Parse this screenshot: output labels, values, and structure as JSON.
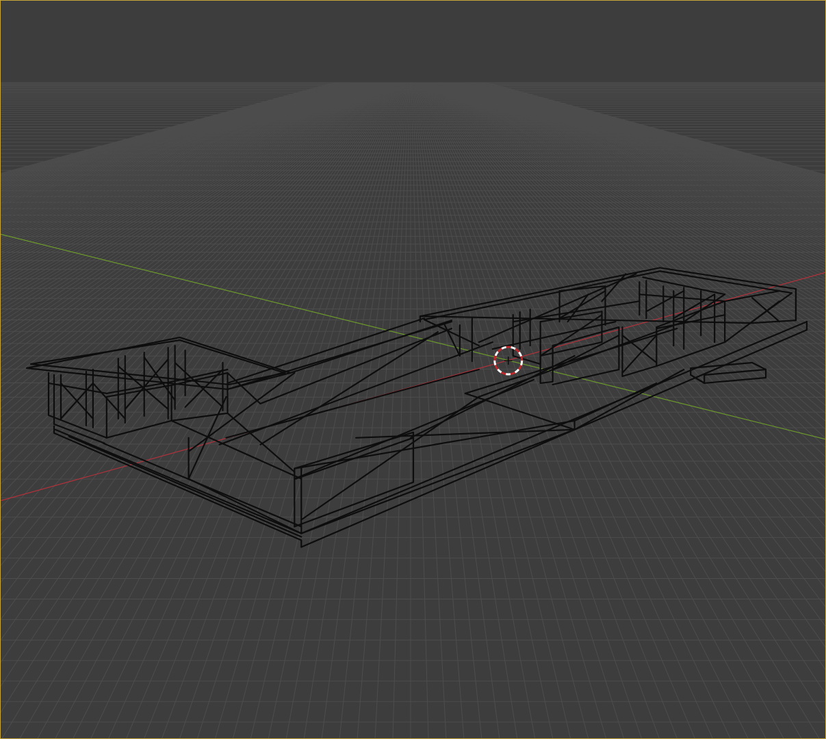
{
  "viewport": {
    "mode": "wireframe",
    "view": "perspective",
    "active_outline_color": "#c9a63a",
    "background_color": "#3d3d3d",
    "grid_color": "#4d4d4d",
    "x_axis_color": "#b3313b",
    "y_axis_color": "#6c9a2b",
    "wire_color": "#0d0d0d"
  },
  "scene": {
    "object": "truss-frame-structure",
    "object_count": 1
  },
  "tools": {
    "cursor": "3d-cursor-icon"
  }
}
